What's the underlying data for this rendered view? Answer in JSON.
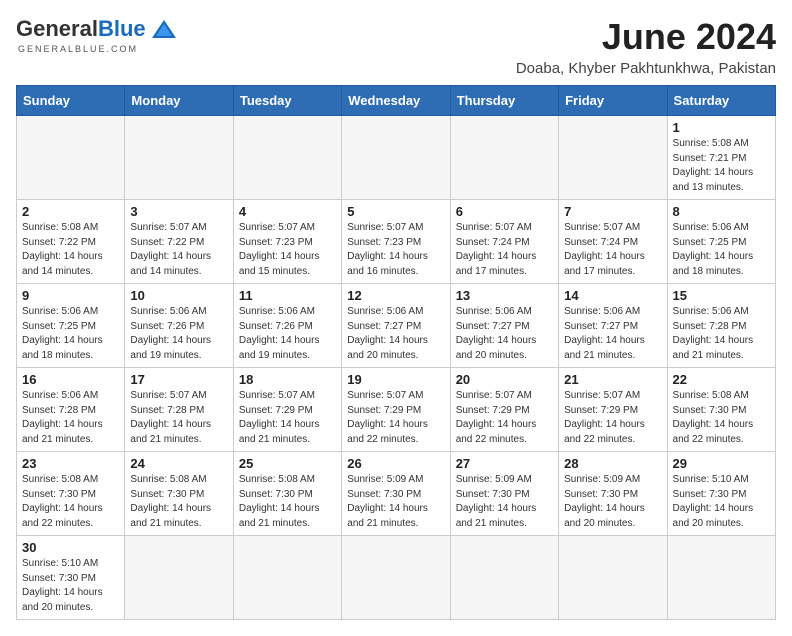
{
  "header": {
    "logo_general": "General",
    "logo_blue": "Blue",
    "logo_tagline": "GENERALBLUE.COM",
    "title": "June 2024",
    "subtitle": "Doaba, Khyber Pakhtunkhwa, Pakistan"
  },
  "weekdays": [
    "Sunday",
    "Monday",
    "Tuesday",
    "Wednesday",
    "Thursday",
    "Friday",
    "Saturday"
  ],
  "weeks": [
    [
      {
        "day": "",
        "info": ""
      },
      {
        "day": "",
        "info": ""
      },
      {
        "day": "",
        "info": ""
      },
      {
        "day": "",
        "info": ""
      },
      {
        "day": "",
        "info": ""
      },
      {
        "day": "",
        "info": ""
      },
      {
        "day": "1",
        "info": "Sunrise: 5:08 AM\nSunset: 7:21 PM\nDaylight: 14 hours\nand 13 minutes."
      }
    ],
    [
      {
        "day": "2",
        "info": "Sunrise: 5:08 AM\nSunset: 7:22 PM\nDaylight: 14 hours\nand 14 minutes."
      },
      {
        "day": "3",
        "info": "Sunrise: 5:07 AM\nSunset: 7:22 PM\nDaylight: 14 hours\nand 14 minutes."
      },
      {
        "day": "4",
        "info": "Sunrise: 5:07 AM\nSunset: 7:23 PM\nDaylight: 14 hours\nand 15 minutes."
      },
      {
        "day": "5",
        "info": "Sunrise: 5:07 AM\nSunset: 7:23 PM\nDaylight: 14 hours\nand 16 minutes."
      },
      {
        "day": "6",
        "info": "Sunrise: 5:07 AM\nSunset: 7:24 PM\nDaylight: 14 hours\nand 17 minutes."
      },
      {
        "day": "7",
        "info": "Sunrise: 5:07 AM\nSunset: 7:24 PM\nDaylight: 14 hours\nand 17 minutes."
      },
      {
        "day": "8",
        "info": "Sunrise: 5:06 AM\nSunset: 7:25 PM\nDaylight: 14 hours\nand 18 minutes."
      }
    ],
    [
      {
        "day": "9",
        "info": "Sunrise: 5:06 AM\nSunset: 7:25 PM\nDaylight: 14 hours\nand 18 minutes."
      },
      {
        "day": "10",
        "info": "Sunrise: 5:06 AM\nSunset: 7:26 PM\nDaylight: 14 hours\nand 19 minutes."
      },
      {
        "day": "11",
        "info": "Sunrise: 5:06 AM\nSunset: 7:26 PM\nDaylight: 14 hours\nand 19 minutes."
      },
      {
        "day": "12",
        "info": "Sunrise: 5:06 AM\nSunset: 7:27 PM\nDaylight: 14 hours\nand 20 minutes."
      },
      {
        "day": "13",
        "info": "Sunrise: 5:06 AM\nSunset: 7:27 PM\nDaylight: 14 hours\nand 20 minutes."
      },
      {
        "day": "14",
        "info": "Sunrise: 5:06 AM\nSunset: 7:27 PM\nDaylight: 14 hours\nand 21 minutes."
      },
      {
        "day": "15",
        "info": "Sunrise: 5:06 AM\nSunset: 7:28 PM\nDaylight: 14 hours\nand 21 minutes."
      }
    ],
    [
      {
        "day": "16",
        "info": "Sunrise: 5:06 AM\nSunset: 7:28 PM\nDaylight: 14 hours\nand 21 minutes."
      },
      {
        "day": "17",
        "info": "Sunrise: 5:07 AM\nSunset: 7:28 PM\nDaylight: 14 hours\nand 21 minutes."
      },
      {
        "day": "18",
        "info": "Sunrise: 5:07 AM\nSunset: 7:29 PM\nDaylight: 14 hours\nand 21 minutes."
      },
      {
        "day": "19",
        "info": "Sunrise: 5:07 AM\nSunset: 7:29 PM\nDaylight: 14 hours\nand 22 minutes."
      },
      {
        "day": "20",
        "info": "Sunrise: 5:07 AM\nSunset: 7:29 PM\nDaylight: 14 hours\nand 22 minutes."
      },
      {
        "day": "21",
        "info": "Sunrise: 5:07 AM\nSunset: 7:29 PM\nDaylight: 14 hours\nand 22 minutes."
      },
      {
        "day": "22",
        "info": "Sunrise: 5:08 AM\nSunset: 7:30 PM\nDaylight: 14 hours\nand 22 minutes."
      }
    ],
    [
      {
        "day": "23",
        "info": "Sunrise: 5:08 AM\nSunset: 7:30 PM\nDaylight: 14 hours\nand 22 minutes."
      },
      {
        "day": "24",
        "info": "Sunrise: 5:08 AM\nSunset: 7:30 PM\nDaylight: 14 hours\nand 21 minutes."
      },
      {
        "day": "25",
        "info": "Sunrise: 5:08 AM\nSunset: 7:30 PM\nDaylight: 14 hours\nand 21 minutes."
      },
      {
        "day": "26",
        "info": "Sunrise: 5:09 AM\nSunset: 7:30 PM\nDaylight: 14 hours\nand 21 minutes."
      },
      {
        "day": "27",
        "info": "Sunrise: 5:09 AM\nSunset: 7:30 PM\nDaylight: 14 hours\nand 21 minutes."
      },
      {
        "day": "28",
        "info": "Sunrise: 5:09 AM\nSunset: 7:30 PM\nDaylight: 14 hours\nand 20 minutes."
      },
      {
        "day": "29",
        "info": "Sunrise: 5:10 AM\nSunset: 7:30 PM\nDaylight: 14 hours\nand 20 minutes."
      }
    ],
    [
      {
        "day": "30",
        "info": "Sunrise: 5:10 AM\nSunset: 7:30 PM\nDaylight: 14 hours\nand 20 minutes."
      },
      {
        "day": "",
        "info": ""
      },
      {
        "day": "",
        "info": ""
      },
      {
        "day": "",
        "info": ""
      },
      {
        "day": "",
        "info": ""
      },
      {
        "day": "",
        "info": ""
      },
      {
        "day": "",
        "info": ""
      }
    ]
  ]
}
